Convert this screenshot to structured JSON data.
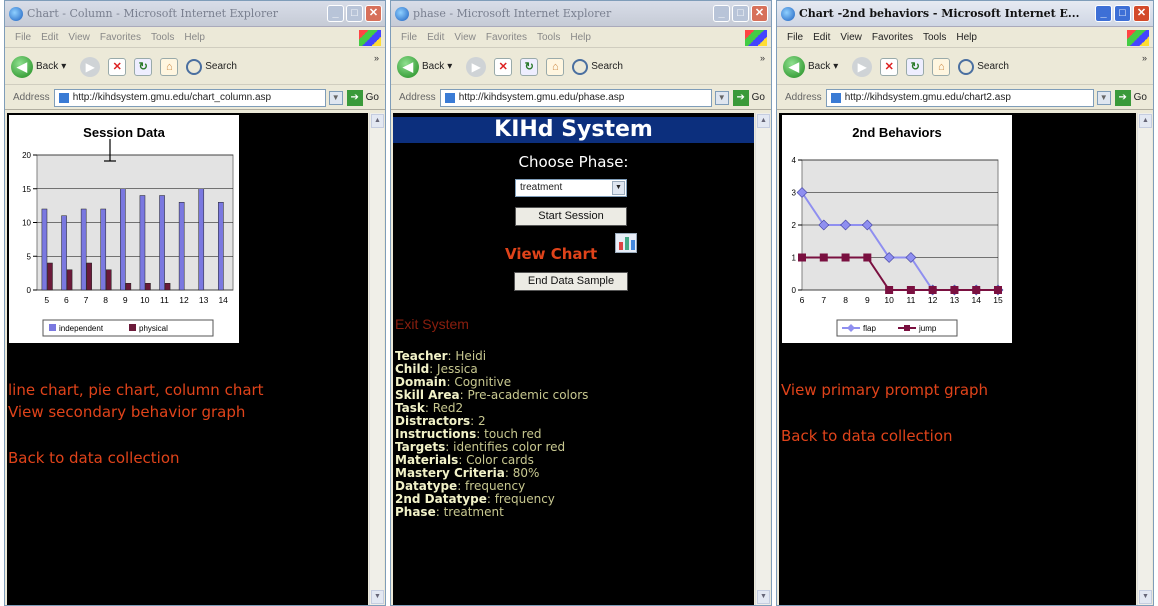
{
  "windows": [
    {
      "title": "Chart - Column - Microsoft Internet Explorer",
      "menu": [
        "File",
        "Edit",
        "View",
        "Favorites",
        "Tools",
        "Help"
      ],
      "back_label": "Back",
      "search_label": "Search",
      "address_label": "Address",
      "url": "http://kihdsystem.gmu.edu/chart_column.asp",
      "go_label": "Go"
    },
    {
      "title": "phase - Microsoft Internet Explorer",
      "menu": [
        "File",
        "Edit",
        "View",
        "Favorites",
        "Tools",
        "Help"
      ],
      "back_label": "Back",
      "search_label": "Search",
      "address_label": "Address",
      "url": "http://kihdsystem.gmu.edu/phase.asp",
      "go_label": "Go"
    },
    {
      "title": "Chart -2nd behaviors - Microsoft Internet E...",
      "menu": [
        "File",
        "Edit",
        "View",
        "Favorites",
        "Tools",
        "Help"
      ],
      "back_label": "Back",
      "search_label": "Search",
      "address_label": "Address",
      "url": "http://kihdsystem.gmu.edu/chart2.asp",
      "go_label": "Go"
    }
  ],
  "left_page": {
    "links": [
      "line chart, pie chart, column chart",
      "View secondary behavior graph",
      "Back to data collection"
    ]
  },
  "center_page": {
    "header": "KIHd System",
    "choose_label": "Choose Phase:",
    "phase_selected": "treatment",
    "start_button": "Start Session",
    "view_chart": "View Chart",
    "end_button": "End Data Sample",
    "exit": "Exit System",
    "info": [
      {
        "key": "Teacher",
        "value": "Heidi"
      },
      {
        "key": "Child",
        "value": "Jessica"
      },
      {
        "key": "Domain",
        "value": "Cognitive"
      },
      {
        "key": "Skill Area",
        "value": "Pre-academic colors"
      },
      {
        "key": "Task",
        "value": "Red2"
      },
      {
        "key": "Distractors",
        "value": "2"
      },
      {
        "key": "Instructions",
        "value": "touch red"
      },
      {
        "key": "Targets",
        "value": "identifies color red"
      },
      {
        "key": "Materials",
        "value": "Color cards"
      },
      {
        "key": "Mastery Criteria",
        "value": "80%"
      },
      {
        "key": "Datatype",
        "value": "frequency"
      },
      {
        "key": "2nd Datatype",
        "value": "frequency"
      },
      {
        "key": "Phase",
        "value": "treatment"
      }
    ]
  },
  "right_page": {
    "links": [
      "View primary prompt graph",
      "Back to data collection"
    ]
  },
  "colors": {
    "independent": "#7a78e0",
    "physical": "#6b1a3a",
    "flap": "#8f8ff0",
    "jump": "#7a1040",
    "link_red": "#e0431a",
    "header_blue": "#0c2f7d"
  },
  "chart_data": [
    {
      "type": "bar",
      "title": "Session Data",
      "categories": [
        "5",
        "6",
        "7",
        "8",
        "9",
        "10",
        "11",
        "12",
        "13",
        "14"
      ],
      "series": [
        {
          "name": "independent",
          "values": [
            12,
            11,
            12,
            12,
            15,
            14,
            14,
            13,
            15,
            13
          ]
        },
        {
          "name": "physical",
          "values": [
            4,
            3,
            4,
            3,
            1,
            1,
            1,
            0,
            0,
            0
          ]
        }
      ],
      "yticks": [
        "0",
        "5",
        "10",
        "15",
        "20"
      ],
      "ylim": [
        0,
        20
      ],
      "grid": true,
      "legend": "bottom"
    },
    {
      "type": "line",
      "title": "2nd Behaviors",
      "categories": [
        "6",
        "7",
        "8",
        "9",
        "10",
        "11",
        "12",
        "13",
        "14",
        "15"
      ],
      "series": [
        {
          "name": "flap",
          "values": [
            3,
            2,
            2,
            2,
            1,
            1,
            0,
            0,
            0,
            0
          ]
        },
        {
          "name": "jump",
          "values": [
            1,
            1,
            1,
            1,
            0,
            0,
            0,
            0,
            0,
            0
          ]
        }
      ],
      "yticks": [
        "0",
        "1",
        "2",
        "3",
        "4"
      ],
      "ylim": [
        0,
        4
      ],
      "grid": true,
      "legend": "bottom"
    }
  ]
}
